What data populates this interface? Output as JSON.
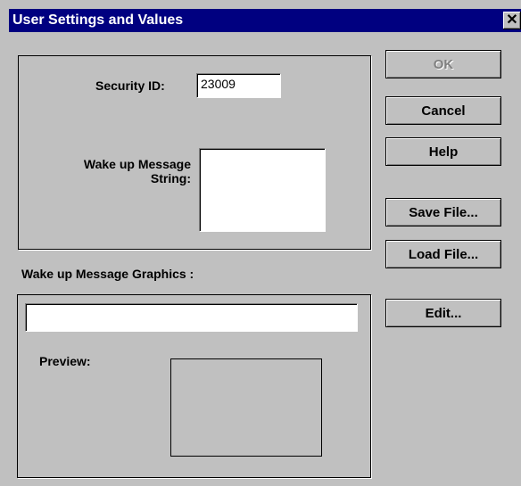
{
  "window": {
    "title": "User Settings and Values",
    "close_glyph": "✕"
  },
  "security": {
    "label": "Security ID:",
    "value": "23009"
  },
  "wakeup_string": {
    "label_line1": "Wake up Message",
    "label_line2": "String:",
    "value": ""
  },
  "graphics": {
    "label": "Wake up Message Graphics :",
    "path_value": "",
    "preview_label": "Preview:"
  },
  "buttons": {
    "ok": "OK",
    "cancel": "Cancel",
    "help": "Help",
    "save_file": "Save File...",
    "load_file": "Load File...",
    "edit": "Edit..."
  },
  "colors": {
    "titlebar": "#000080",
    "face": "#c0c0c0"
  }
}
